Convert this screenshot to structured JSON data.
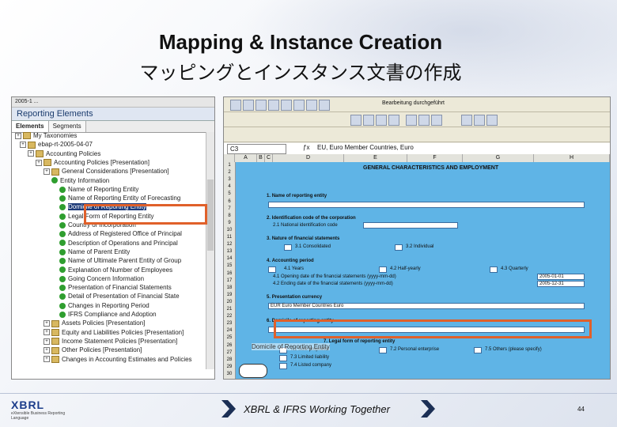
{
  "slide": {
    "title_en": "Mapping & Instance Creation",
    "title_ja": "マッピングとインスタンス文書の作成",
    "footer": "XBRL & IFRS Working Together",
    "page_number": "44",
    "logo": "XBRL",
    "logo_sub": "eXtensible Business Reporting Language"
  },
  "left_panel": {
    "topbar": "2005-1 ...",
    "title": "Reporting Elements",
    "tabs": [
      "Elements",
      "Segments"
    ],
    "tree": [
      {
        "label": "My Taxonomies",
        "icon": "folder"
      },
      {
        "label": "ebap-rt-2005-04-07",
        "icon": "folder"
      },
      {
        "label": "Accounting Policies",
        "icon": "folder"
      },
      {
        "label": "Accounting Policies [Presentation]",
        "icon": "folder"
      },
      {
        "label": "General Considerations [Presentation]",
        "icon": "folder"
      },
      {
        "label": "Entity Information",
        "icon": "bullet"
      },
      {
        "label": "Name of Reporting Entity",
        "icon": "bullet"
      },
      {
        "label": "Name of Reporting Entity of Forecasting",
        "icon": "bullet"
      },
      {
        "label": "Domicile of Reporting Entity",
        "icon": "bullet",
        "selected": true
      },
      {
        "label": "Legal Form of Reporting Entity",
        "icon": "bullet"
      },
      {
        "label": "Country of Incorporation",
        "icon": "bullet"
      },
      {
        "label": "Address of Registered Office of Principal",
        "icon": "bullet"
      },
      {
        "label": "Description of Operations and Principal",
        "icon": "bullet"
      },
      {
        "label": "Name of Parent Entity",
        "icon": "bullet"
      },
      {
        "label": "Name of Ultimate Parent Entity of Group",
        "icon": "bullet"
      },
      {
        "label": "Explanation of Number of Employees",
        "icon": "bullet"
      },
      {
        "label": "Going Concern Information",
        "icon": "bullet"
      },
      {
        "label": "Presentation of Financial Statements",
        "icon": "bullet"
      },
      {
        "label": "Detail of Presentation of Financial State",
        "icon": "bullet"
      },
      {
        "label": "Changes in Reporting Period",
        "icon": "bullet"
      },
      {
        "label": "IFRS Compliance and Adoption",
        "icon": "bullet"
      },
      {
        "label": "Assets Policies [Presentation]",
        "icon": "folder"
      },
      {
        "label": "Equity and Liabilities Policies [Presentation]",
        "icon": "folder"
      },
      {
        "label": "Income Statement Policies [Presentation]",
        "icon": "folder"
      },
      {
        "label": "Other Policies [Presentation]",
        "icon": "folder"
      },
      {
        "label": "Changes in Accounting Estimates and Policies",
        "icon": "folder"
      }
    ]
  },
  "right_panel": {
    "toolbar_text": "Bearbeitung durchgeführt",
    "namebox": "C3",
    "formula": "EU, Euro Member Countries, Euro",
    "columns": [
      "A",
      "B",
      "C",
      "D",
      "E",
      "F",
      "G",
      "H"
    ],
    "row_numbers": [
      "1",
      "2",
      "3",
      "4",
      "5",
      "6",
      "7",
      "8",
      "9",
      "10",
      "11",
      "12",
      "13",
      "14",
      "15",
      "16",
      "17",
      "18",
      "19",
      "20",
      "21",
      "22",
      "23",
      "24",
      "25",
      "26",
      "27",
      "28",
      "29",
      "30"
    ],
    "sheet_title": "GENERAL CHARACTERISTICS AND EMPLOYMENT",
    "items": [
      {
        "num": "1.",
        "text": "Name of reporting entity"
      },
      {
        "num": "2.",
        "text": "Identification code of the corporation"
      },
      {
        "num": "",
        "text": "2.1 National identification code"
      },
      {
        "num": "3.",
        "text": "Nature of financial statements"
      },
      {
        "num": "",
        "text": "3.1 Consolidated"
      },
      {
        "num": "",
        "text": "3.2 Individual"
      },
      {
        "num": "4.",
        "text": "Accounting period"
      },
      {
        "num": "",
        "text": "4.1 Years"
      },
      {
        "num": "",
        "text": "4.2 Half-yearly"
      },
      {
        "num": "",
        "text": "4.3 Quarterly"
      },
      {
        "num": "",
        "text": "4.1 Opening date of the financial statements (yyyy-mm-dd)"
      },
      {
        "num": "",
        "text": "4.2 Ending date of the financial statements (yyyy-mm-dd)"
      },
      {
        "num": "5.",
        "text": "Presentation currency"
      },
      {
        "num": "6.",
        "text": "Domicile of reporting entity"
      },
      {
        "num": "7.",
        "text": "Legal form of reporting entity"
      },
      {
        "num": "",
        "text": "7.1 Sole proprietor"
      },
      {
        "num": "",
        "text": "7.2 Personal enterprise"
      },
      {
        "num": "",
        "text": "7.3 Limited liability"
      },
      {
        "num": "",
        "text": "7.4 Listed company"
      },
      {
        "num": "",
        "text": "7.5 Others (please specify)"
      }
    ],
    "currency_value": "EUR Euro Member Countries Euro",
    "date_open": "2005-01-01",
    "date_end": "2005-12-31",
    "overlay_label": "Domicile of Reporting Entity"
  },
  "colors": {
    "highlight": "#e0602a",
    "sheet": "#5fb4e6",
    "selection": "#1f3b78"
  }
}
